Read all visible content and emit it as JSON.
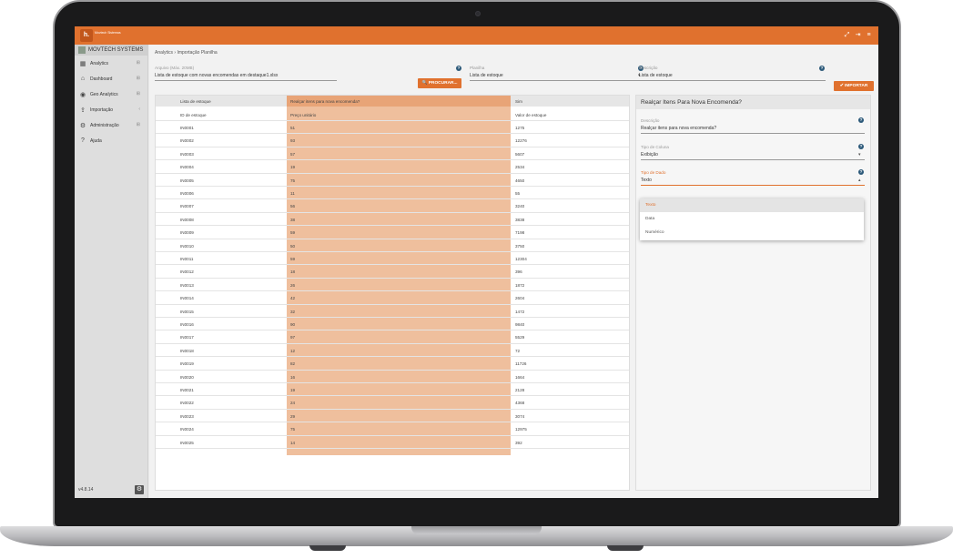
{
  "app": {
    "logo_letter": "h.",
    "logo_text": "Movtech Sistemas",
    "company": "MOVTECH SYSTEMS",
    "version": "v4.8.14",
    "accent": "#e0712e"
  },
  "topbar_icons": [
    "expand-icon",
    "logout-icon",
    "menu-icon"
  ],
  "sidebar": {
    "items": [
      {
        "label": "Analytics",
        "icon": "table-icon",
        "expand": "⊞"
      },
      {
        "label": "Dashboard",
        "icon": "home-icon",
        "expand": "⊞"
      },
      {
        "label": "Geo Analytics",
        "icon": "globe-icon",
        "expand": "⊞"
      },
      {
        "label": "Importação",
        "icon": "upload-icon",
        "expand": "‹"
      },
      {
        "label": "Administração",
        "icon": "gear-icon",
        "expand": "⊞"
      },
      {
        "label": "Ajuda",
        "icon": "help-icon",
        "expand": ""
      }
    ]
  },
  "breadcrumb": "Analytics  ›  Importação Planilha",
  "form": {
    "arquivo_label": "Arquivo (Máx. 20MB)",
    "arquivo_value": "Lista de estoque com novas encomendas em destaque1.xlsx",
    "procurar_label": "🔍 PROCURAR...",
    "planilha_label": "Planilha",
    "planilha_value": "Lista de estoque",
    "descricao_label": "Descrição",
    "descricao_value": "Lista de estoque",
    "importar_label": "✔ IMPORTAR"
  },
  "table": {
    "sheet_headers": [
      "Lista de estoque",
      "Realçar itens para nova encomenda?",
      "Sim"
    ],
    "columns": [
      "ID de estoque",
      "Preço unitário",
      "Valor de estoque"
    ],
    "rows": [
      [
        "IN0001",
        "51",
        "1275"
      ],
      [
        "IN0002",
        "93",
        "12276"
      ],
      [
        "IN0003",
        "57",
        "5607"
      ],
      [
        "IN0004",
        "19",
        "2534"
      ],
      [
        "IN0005",
        "75",
        "4650"
      ],
      [
        "IN0006",
        "11",
        "55"
      ],
      [
        "IN0007",
        "56",
        "3240"
      ],
      [
        "IN0008",
        "38",
        "3838"
      ],
      [
        "IN0009",
        "59",
        "7198"
      ],
      [
        "IN0010",
        "50",
        "3750"
      ],
      [
        "IN0011",
        "59",
        "12304"
      ],
      [
        "IN0012",
        "18",
        "396"
      ],
      [
        "IN0013",
        "26",
        "1872"
      ],
      [
        "IN0014",
        "42",
        "2604"
      ],
      [
        "IN0015",
        "32",
        "1472"
      ],
      [
        "IN0016",
        "90",
        "9840"
      ],
      [
        "IN0017",
        "97",
        "5529"
      ],
      [
        "IN0018",
        "12",
        "72"
      ],
      [
        "IN0019",
        "82",
        "11726"
      ],
      [
        "IN0020",
        "16",
        "1664"
      ],
      [
        "IN0021",
        "19",
        "2128"
      ],
      [
        "IN0022",
        "24",
        "4368"
      ],
      [
        "IN0023",
        "29",
        "3074"
      ],
      [
        "IN0024",
        "75",
        "12975"
      ],
      [
        "IN0025",
        "14",
        "392"
      ]
    ]
  },
  "panel": {
    "title": "Realçar Itens Para Nova Encomenda?",
    "descricao_label": "Descrição",
    "descricao_value": "Realçar itens para nova encomenda?",
    "tipo_coluna_label": "Tipo de Coluna",
    "tipo_coluna_value": "Exibição",
    "tipo_dado_label": "Tipo de Dado",
    "tipo_dado_value": "Texto",
    "options": [
      "Texto",
      "Data",
      "Numérico"
    ]
  }
}
